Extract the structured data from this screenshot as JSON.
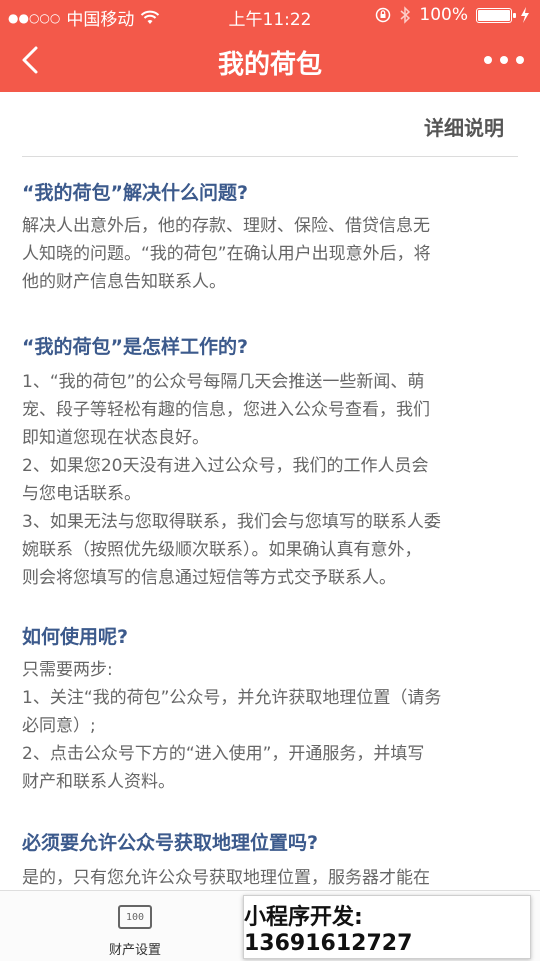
{
  "status_bar": {
    "signal": "●●○○○",
    "carrier": "中国移动",
    "time": "上午11:22",
    "battery": "100%"
  },
  "nav": {
    "title": "我的荷包"
  },
  "detail_header": "详细说明",
  "sections": [
    {
      "title": "“我的荷包”解决什么问题?",
      "body": "解决人出意外后，他的存款、理财、保险、借贷信息无\n人知晓的问题。“我的荷包”在确认用户出现意外后，将\n他的财产信息告知联系人。"
    },
    {
      "title": "“我的荷包”是怎样工作的?",
      "body": "1、“我的荷包”的公众号每隔几天会推送一些新闻、萌\n宠、段子等轻松有趣的信息，您进入公众号查看，我们\n即知道您现在状态良好。\n2、如果您20天没有进入过公众号，我们的工作人员会\n与您电话联系。\n3、如果无法与您取得联系，我们会与您填写的联系人委\n婉联系（按照优先级顺次联系）。如果确认真有意外，\n则会将您填写的信息通过短信等方式交予联系人。"
    },
    {
      "title": "如何使用呢?",
      "body": "只需要两步:\n1、关注“我的荷包”公众号，并允许获取地理位置（请务\n必同意）;\n2、点击公众号下方的“进入使用”，开通服务，并填写\n财产和联系人资料。"
    },
    {
      "title": "必须要允许公众号获取地理位置吗?",
      "body": "是的，只有您允许公众号获取地理位置，服务器才能在"
    }
  ],
  "tabbar": {
    "tab1_icon_text": "100",
    "tab1_label": "财产设置"
  },
  "overlay": "小程序开发: 13691612727",
  "colors": {
    "primary": "#f3594a",
    "section_title": "#3c5a8c",
    "body_text": "#666666"
  }
}
